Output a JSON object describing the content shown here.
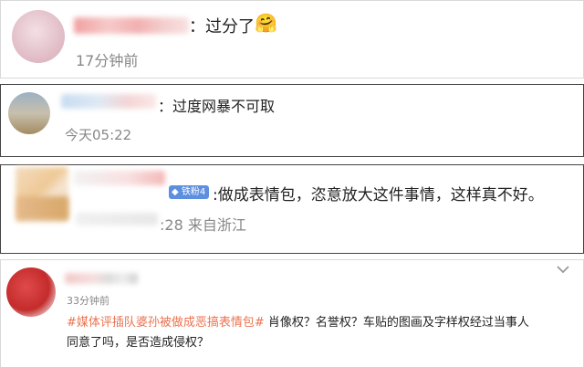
{
  "comments": [
    {
      "text": "：过分了",
      "emoji": "🤗",
      "time": "17分钟前"
    },
    {
      "text": "：过度网暴不可取",
      "time": "今天05:22"
    },
    {
      "badge": "铁粉4",
      "text": ":做成表情包，恣意放大这件事情，这样真不好。",
      "time": ":28 来自浙江"
    },
    {
      "time": "33分钟前",
      "hashtag": "#媒体评插队婆孙被做成恶搞表情包#",
      "text_line1": " 肖像权？名誉权？车贴的图画及字样权经过当事人",
      "text_line2": "同意了吗，是否造成侵权？"
    }
  ],
  "icons": {
    "badge_icon": "heart-diamond-icon",
    "menu": "chevron-down-icon"
  },
  "colors": {
    "badge": "#5c8fe0",
    "hashtag": "#eb7350",
    "meta": "#888888"
  }
}
